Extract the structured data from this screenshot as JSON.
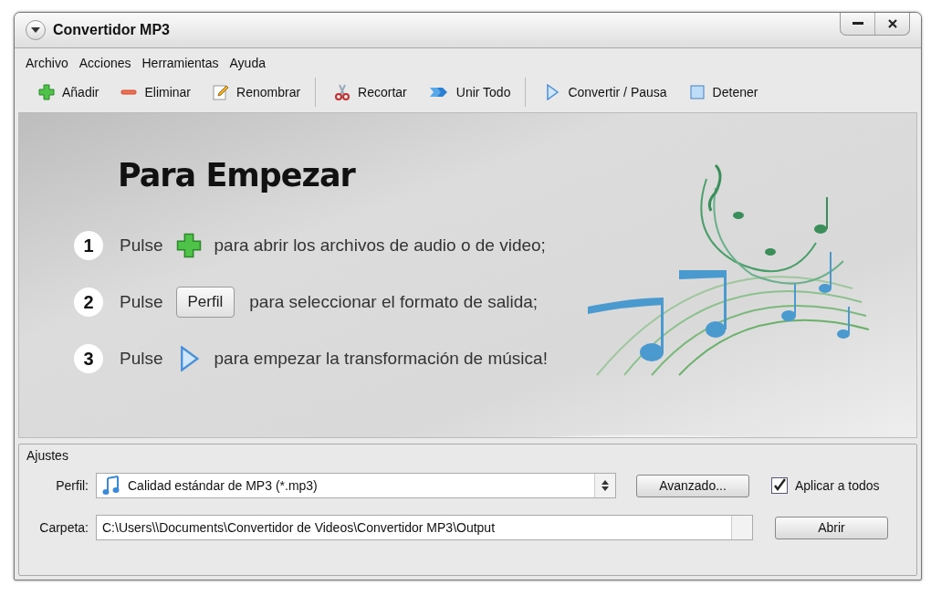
{
  "window": {
    "title": "Convertidor MP3"
  },
  "menu": [
    "Archivo",
    "Acciones",
    "Herramientas",
    "Ayuda"
  ],
  "toolbar": [
    [
      {
        "kind": "add",
        "label": "Añadir"
      },
      {
        "kind": "remove",
        "label": "Eliminar"
      },
      {
        "kind": "rename",
        "label": "Renombrar"
      }
    ],
    [
      {
        "kind": "cut",
        "label": "Recortar"
      },
      {
        "kind": "merge",
        "label": "Unir Todo"
      }
    ],
    [
      {
        "kind": "convert",
        "label": "Convertir / Pausa"
      },
      {
        "kind": "stop",
        "label": "Detener"
      }
    ]
  ],
  "welcome": {
    "heading": "Para Empezar",
    "steps": [
      {
        "number": "1",
        "verb": "Pulse",
        "kind": "add",
        "text": "para abrir los archivos de audio o de video;"
      },
      {
        "number": "2",
        "verb": "Pulse",
        "kind": "button",
        "button_label": "Perfil",
        "text": "para seleccionar el formato de salida;"
      },
      {
        "number": "3",
        "verb": "Pulse",
        "kind": "convert",
        "text": "para empezar la transformación de música!"
      }
    ]
  },
  "settings": {
    "title": "Ajustes",
    "profile_label": "Perfil:",
    "profile_value": "Calidad estándar de MP3 (*.mp3)",
    "advanced_button": "Avanzado...",
    "apply_all": {
      "label": "Aplicar a todos",
      "checked": true
    },
    "folder_label": "Carpeta:",
    "folder_value": "C:\\Users\\\\Documents\\Convertidor de Videos\\Convertidor MP3\\Output",
    "open_button": "Abrir"
  }
}
